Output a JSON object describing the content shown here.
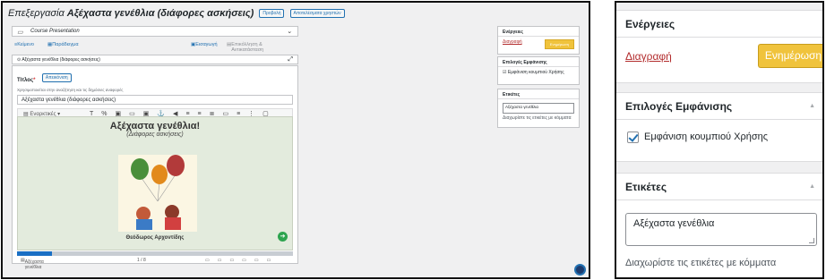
{
  "editor": {
    "page_title_prefix": "Επεξεργασία",
    "page_title_name": "Αξέχαστα γενέθλια (διάφορες ασκήσεις)",
    "title_buttons": [
      "Προβολή",
      "Αποτελέσματα χρηστών"
    ],
    "content_type": "Course Presentation",
    "tab_text": "Κείμενο",
    "tab_paragraph": "Παράδειγμα",
    "btn_insert": "Εισαγωγή",
    "btn_copyright": "Επικόλληση & Αντικατάσταση",
    "box_heading": "Αξέχαστα γενέθλια (διάφορες ασκήσεις)",
    "title_label": "Τίτλος",
    "title_required": "*",
    "title_help": "Χρησιμοποιείται στην αναζήτηση και τις δημόσιες αναφορές",
    "title_help_btn": "Απεικόνιση",
    "title_value": "Αξέχαστα γενέθλια (διάφορες ασκήσεις)",
    "toolbar_dropdown": "Εναρκτικές",
    "slide": {
      "title": "Αξέχαστα γενέθλια!",
      "subtitle": "(Διάφορες ασκήσεις)",
      "author": "Θεόδωρος Αρχοντίδης",
      "progress_fraction": 0.125
    },
    "footer_title": "Αξέχαστα γενέθλια",
    "footer_pager": "1 / 8"
  },
  "sidebar": {
    "actions": {
      "title": "Ενέργειες",
      "delete_label": "Διαγραφή",
      "update_label": "Ενημέρωση"
    },
    "display": {
      "title": "Επιλογές Εμφάνισης",
      "checkbox_label": "Εμφάνιση κουμπιού Χρήσης",
      "checked": true
    },
    "tags": {
      "title": "Ετικέτες",
      "value": "Αξέχαστα γενέθλια",
      "help": "Διαχωρίστε τις ετικέτες με κόμματα"
    }
  },
  "colors": {
    "update_button": "#f0c33c",
    "delete_link": "#b32d2e",
    "link_blue": "#2271b1",
    "progress": "#1a6fc4"
  },
  "icons": [
    "content-type-icon",
    "chevron-down-icon",
    "expand-icon",
    "next-slide-icon",
    "help-icon",
    "arrow-up-icon",
    "checkbox-check-icon"
  ]
}
